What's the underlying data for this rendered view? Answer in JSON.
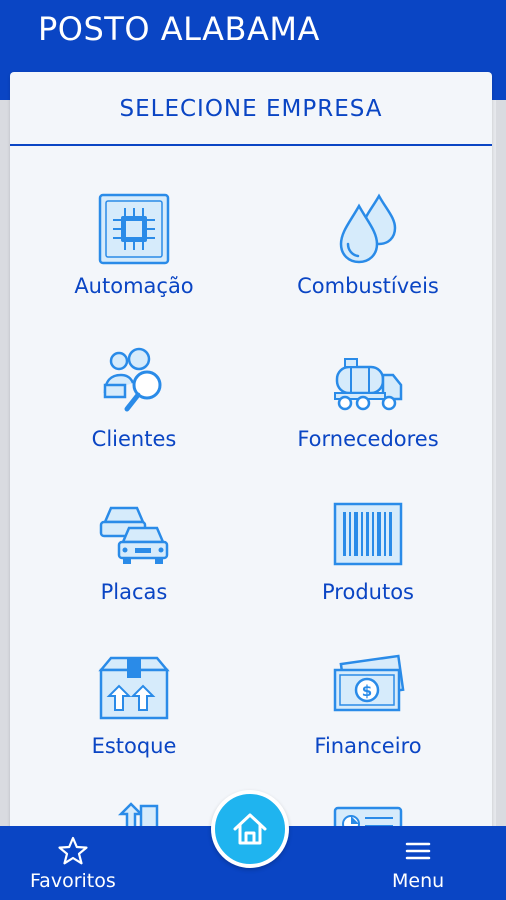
{
  "app": {
    "title": "POSTO ALABAMA"
  },
  "panel": {
    "title": "SELECIONE EMPRESA"
  },
  "menu_items": [
    {
      "label": "Automação",
      "icon": "chip-icon"
    },
    {
      "label": "Combustíveis",
      "icon": "fuel-drops-icon"
    },
    {
      "label": "Clientes",
      "icon": "client-search-icon"
    },
    {
      "label": "Fornecedores",
      "icon": "tanker-truck-icon"
    },
    {
      "label": "Placas",
      "icon": "cars-icon"
    },
    {
      "label": "Produtos",
      "icon": "barcode-icon"
    },
    {
      "label": "Estoque",
      "icon": "box-icon"
    },
    {
      "label": "Financeiro",
      "icon": "money-icon"
    }
  ],
  "bottom_nav": {
    "favorites_label": "Favoritos",
    "menu_label": "Menu",
    "home_icon": "home-icon"
  },
  "colors": {
    "primary": "#0a45c4",
    "icon_blue": "#2a8be8",
    "home_button": "#1fb4ef",
    "panel_bg": "#f3f6fa"
  }
}
